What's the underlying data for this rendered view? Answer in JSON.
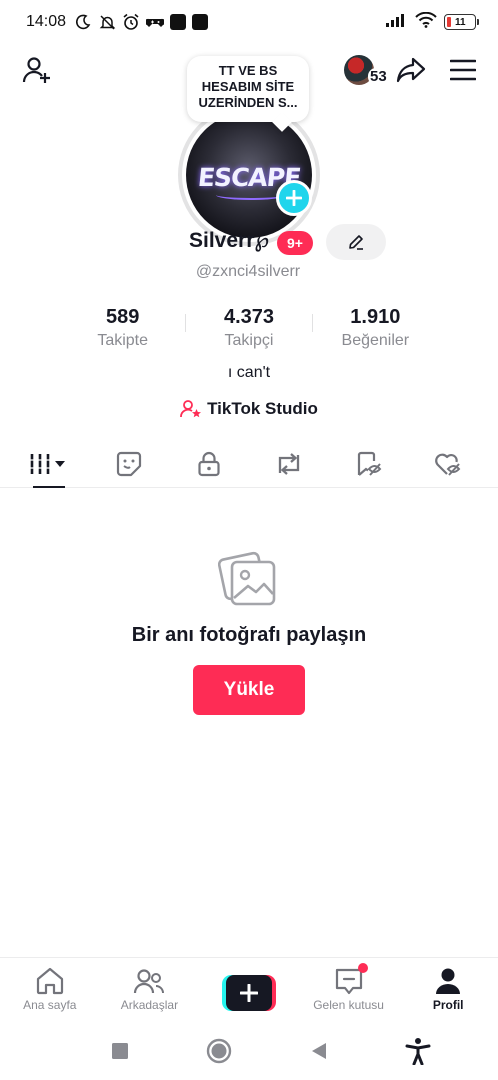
{
  "status_bar": {
    "time": "14:08",
    "battery_text": "11",
    "battery_color": "#e53935",
    "icons": [
      "moon-icon",
      "bell-off-icon",
      "alarm-icon",
      "game-icon",
      "app-square-icon",
      "app-square-icon",
      "signal-icon",
      "wifi-icon",
      "battery-icon"
    ]
  },
  "top_nav": {
    "visitor_count": "53",
    "icons": [
      "add-friend-icon",
      "share-icon",
      "menu-icon"
    ]
  },
  "profile": {
    "note": "TT VE BS HESABIM SİTE UZERİNDEN S...",
    "display_name": "Silverr℘",
    "badge": "9+",
    "username": "@zxnci4silverr",
    "avatar_text": "ESCAPE",
    "bio": "ı can't"
  },
  "stats": [
    {
      "number": "589",
      "label": "Takipte"
    },
    {
      "number": "4.373",
      "label": "Takipçi"
    },
    {
      "number": "1.910",
      "label": "Beğeniler"
    }
  ],
  "studio": {
    "label": "TikTok Studio"
  },
  "tabs": [
    "videos-grid-icon",
    "sticker-icon",
    "lock-icon",
    "repost-icon",
    "hidden-favorites-icon",
    "liked-hidden-icon"
  ],
  "empty_state": {
    "title": "Bir anı fotoğrafı paylaşın",
    "button": "Yükle"
  },
  "bottom_nav": {
    "items": [
      {
        "label": "Ana sayfa",
        "icon": "home-icon"
      },
      {
        "label": "Arkadaşlar",
        "icon": "friends-icon"
      },
      {
        "label": "",
        "icon": "create-plus-icon"
      },
      {
        "label": "Gelen kutusu",
        "icon": "inbox-icon"
      },
      {
        "label": "Profil",
        "icon": "profile-icon"
      }
    ]
  },
  "colors": {
    "accent": "#fe2c55",
    "cyan": "#25f4ee",
    "text": "#161823",
    "muted": "#8a8b91"
  }
}
